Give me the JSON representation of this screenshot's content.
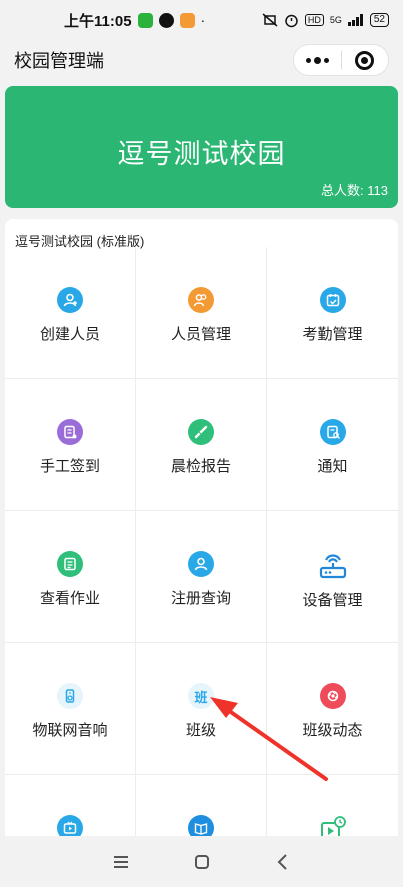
{
  "status_bar": {
    "time": "上午11:05",
    "network": "HD",
    "signal": "5G",
    "battery": "52"
  },
  "title_bar": {
    "title": "校园管理端"
  },
  "banner": {
    "school_name": "逗号测试校园",
    "total_label": "总人数:",
    "total_value": "113",
    "color": "#2bb673"
  },
  "card": {
    "edition": "逗号测试校园 (标准版)"
  },
  "grid": {
    "items": [
      {
        "label": "创建人员",
        "icon": "create-person-icon",
        "color": "#29a8e8"
      },
      {
        "label": "人员管理",
        "icon": "people-management-icon",
        "color": "#f39a35"
      },
      {
        "label": "考勤管理",
        "icon": "attendance-calendar-icon",
        "color": "#29a8e8"
      },
      {
        "label": "手工签到",
        "icon": "manual-checkin-icon",
        "color": "#9a6cd8"
      },
      {
        "label": "晨检报告",
        "icon": "morning-check-icon",
        "color": "#2fbf7a"
      },
      {
        "label": "通知",
        "icon": "notice-icon",
        "color": "#29a8e8"
      },
      {
        "label": "查看作业",
        "icon": "homework-icon",
        "color": "#2fbf7a"
      },
      {
        "label": "注册查询",
        "icon": "register-query-icon",
        "color": "#29a8e8"
      },
      {
        "label": "设备管理",
        "icon": "device-router-icon",
        "color": "#2286d9"
      },
      {
        "label": "物联网音响",
        "icon": "speaker-icon",
        "color": "#29a8e8"
      },
      {
        "label": "班级",
        "icon": "class-icon",
        "icon_text": "班",
        "color": "#29a8e8"
      },
      {
        "label": "班级动态",
        "icon": "class-moments-icon",
        "color": "#ee4b5b"
      },
      {
        "label": "",
        "icon": "video-icon",
        "color": "#29a8e8"
      },
      {
        "label": "",
        "icon": "book-icon",
        "color": "#1e8fe0"
      },
      {
        "label": "",
        "icon": "playback-icon",
        "color": "#2fbf7a"
      }
    ]
  },
  "annotation": {
    "arrow_color": "#f0332a"
  }
}
